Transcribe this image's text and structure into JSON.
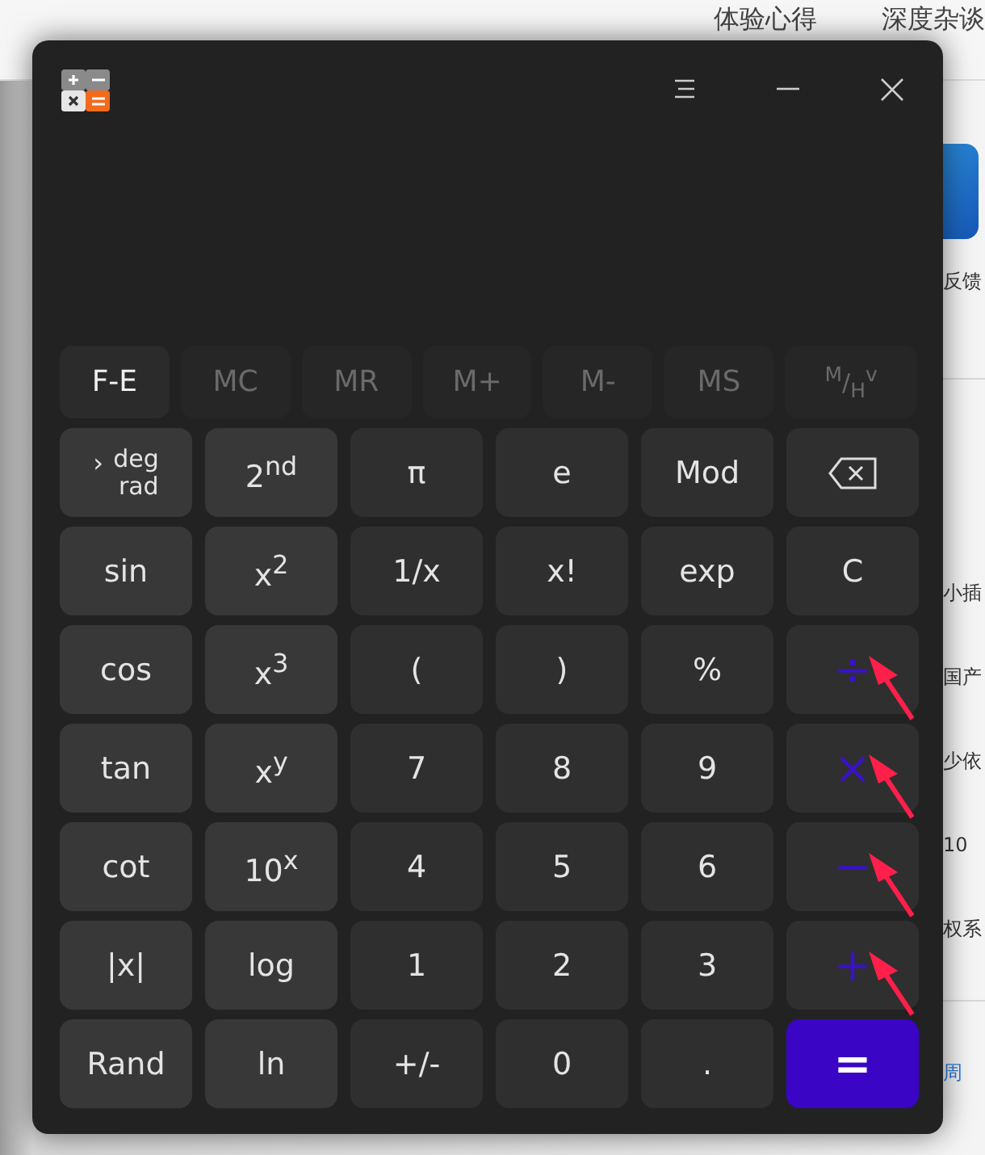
{
  "background": {
    "tabs": [
      "体验心得",
      "深度杂谈"
    ],
    "tile_caption": "反馈",
    "list_items": [
      "小插",
      "国产",
      "少依",
      "10",
      "权系"
    ],
    "link": "周"
  },
  "memory_keys": [
    {
      "label": "F-E",
      "disabled": false
    },
    {
      "label": "MC",
      "disabled": true
    },
    {
      "label": "MR",
      "disabled": true
    },
    {
      "label": "M+",
      "disabled": true
    },
    {
      "label": "M-",
      "disabled": true
    },
    {
      "label": "MS",
      "disabled": true
    },
    {
      "label": "$^{M}$/$_{H}$$^{v}$",
      "disabled": true
    }
  ],
  "keys": [
    {
      "kind": "angle",
      "prefix": "›",
      "lines": [
        "deg",
        "rad"
      ]
    },
    {
      "kind": "function",
      "label": "2$^{nd}$"
    },
    {
      "kind": "plain",
      "label": "π"
    },
    {
      "kind": "plain",
      "label": "e"
    },
    {
      "kind": "plain",
      "label": "Mod"
    },
    {
      "kind": "backspace"
    },
    {
      "kind": "function",
      "label": "sin"
    },
    {
      "kind": "function",
      "label": "x$^{2}$"
    },
    {
      "kind": "plain",
      "label": "1/x"
    },
    {
      "kind": "plain",
      "label": "x!"
    },
    {
      "kind": "plain",
      "label": "exp"
    },
    {
      "kind": "plain",
      "label": "C"
    },
    {
      "kind": "function",
      "label": "cos"
    },
    {
      "kind": "function",
      "label": "x$^{3}$"
    },
    {
      "kind": "plain",
      "label": "("
    },
    {
      "kind": "plain",
      "label": ")"
    },
    {
      "kind": "plain",
      "label": "%"
    },
    {
      "kind": "operator",
      "label": "÷",
      "arrow": true
    },
    {
      "kind": "function",
      "label": "tan"
    },
    {
      "kind": "function",
      "label": "x$^{y}$"
    },
    {
      "kind": "plain",
      "label": "7"
    },
    {
      "kind": "plain",
      "label": "8"
    },
    {
      "kind": "plain",
      "label": "9"
    },
    {
      "kind": "operator",
      "label": "×",
      "arrow": true
    },
    {
      "kind": "function",
      "label": "cot"
    },
    {
      "kind": "function",
      "label": "10$^{x}$"
    },
    {
      "kind": "plain",
      "label": "4"
    },
    {
      "kind": "plain",
      "label": "5"
    },
    {
      "kind": "plain",
      "label": "6"
    },
    {
      "kind": "operator",
      "label": "−",
      "arrow": true
    },
    {
      "kind": "function",
      "label": "|x|"
    },
    {
      "kind": "function",
      "label": "log"
    },
    {
      "kind": "plain",
      "label": "1"
    },
    {
      "kind": "plain",
      "label": "2"
    },
    {
      "kind": "plain",
      "label": "3"
    },
    {
      "kind": "operator",
      "label": "+",
      "arrow": true
    },
    {
      "kind": "function",
      "label": "Rand"
    },
    {
      "kind": "function",
      "label": "ln"
    },
    {
      "kind": "plain",
      "label": "+/-"
    },
    {
      "kind": "plain",
      "label": "0"
    },
    {
      "kind": "plain",
      "label": "."
    },
    {
      "kind": "equals",
      "label": "="
    }
  ]
}
